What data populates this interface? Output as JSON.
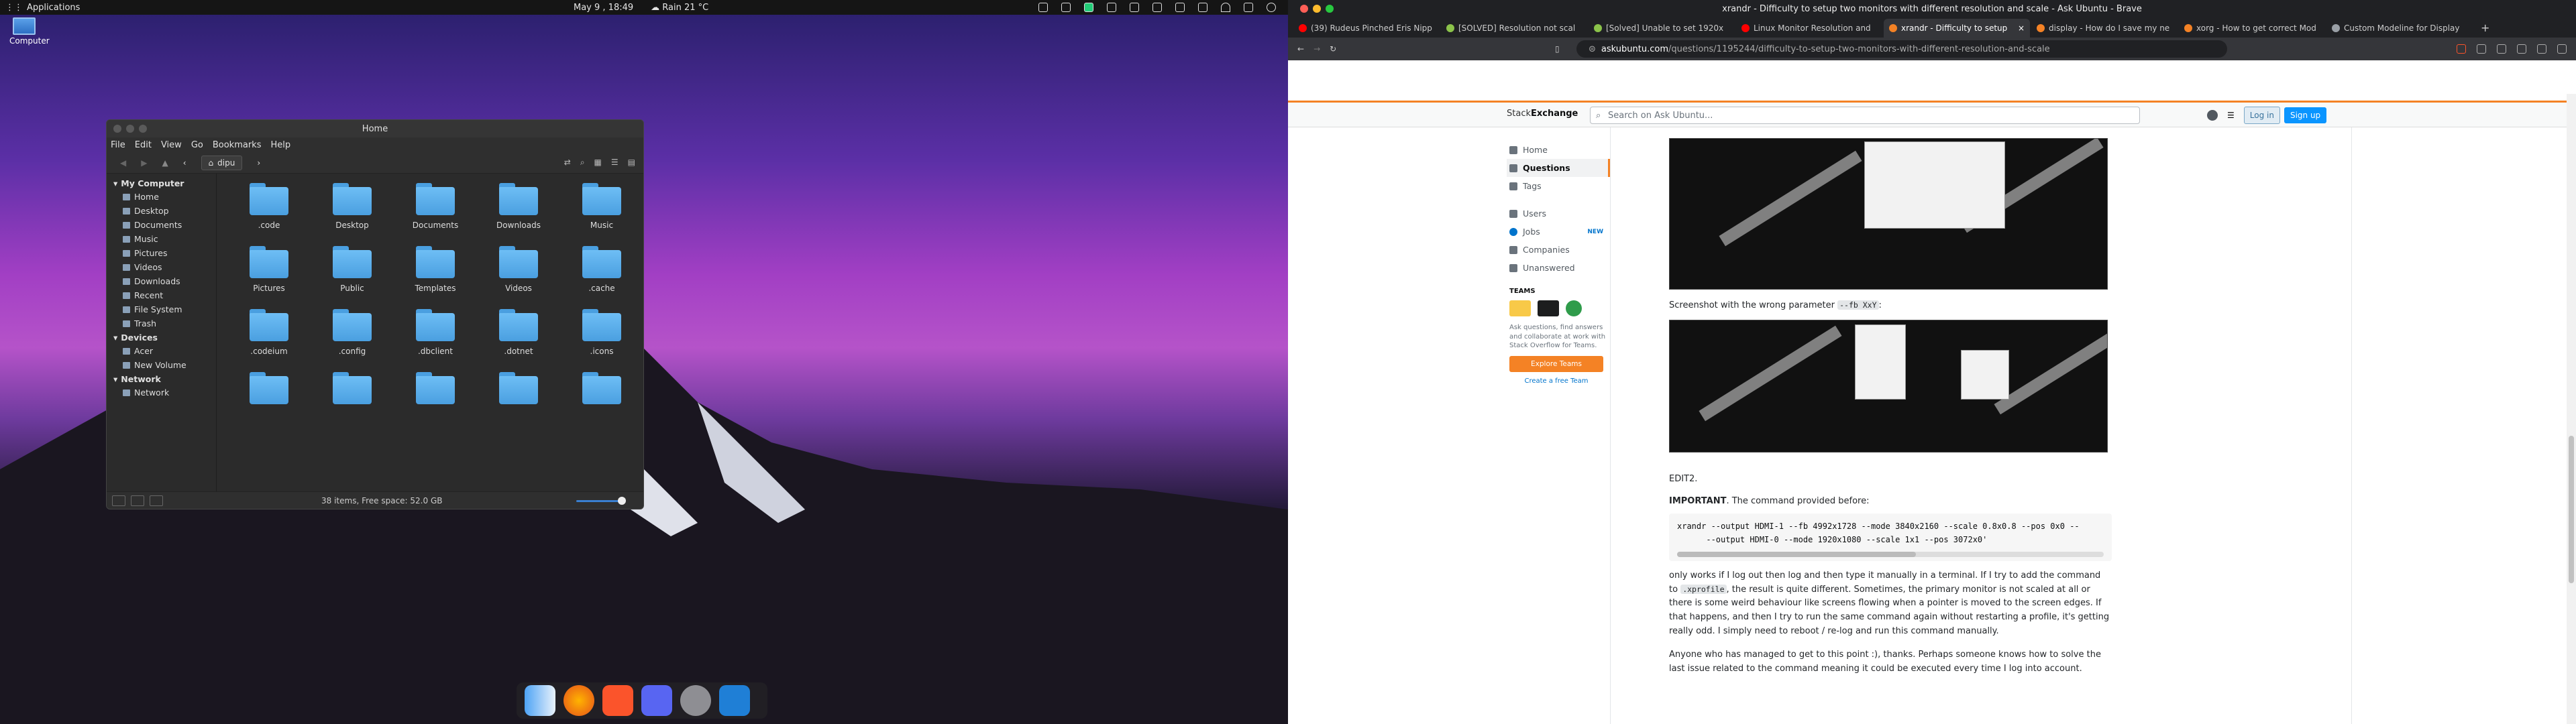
{
  "topbar": {
    "apps_label": "Applications",
    "date": "May 9 , 18:49",
    "weather": "Rain 21 °C"
  },
  "desktop": {
    "computer_label": "Computer"
  },
  "file_manager": {
    "title": "Home",
    "menu": [
      "File",
      "Edit",
      "View",
      "Go",
      "Bookmarks",
      "Help"
    ],
    "path": "dipu",
    "sidebar": {
      "my_computer": "My Computer",
      "places": [
        "Home",
        "Desktop",
        "Documents",
        "Music",
        "Pictures",
        "Videos",
        "Downloads",
        "Recent",
        "File System",
        "Trash"
      ],
      "devices": "Devices",
      "device_items": [
        "Acer",
        "New Volume"
      ],
      "network": "Network",
      "network_items": [
        "Network"
      ]
    },
    "folders": [
      ".code",
      "Desktop",
      "Documents",
      "Downloads",
      "Music",
      "Pictures",
      "Public",
      "Templates",
      "Videos",
      ".cache",
      ".codeium",
      ".config",
      ".dbclient",
      ".dotnet",
      ".icons",
      "",
      "",
      "",
      "",
      ""
    ],
    "status": "38 items, Free space: 52.0 GB"
  },
  "browser": {
    "window_title": "xrandr - Difficulty to setup two monitors with different resolution and scale - Ask Ubuntu - Brave",
    "tabs": [
      {
        "label": "(39) Rudeus Pinched Eris Nipp",
        "color": "#ff0000"
      },
      {
        "label": "[SOLVED] Resolution not scal",
        "color": "#8bc34a"
      },
      {
        "label": "[Solved] Unable to set 1920x",
        "color": "#8bc34a"
      },
      {
        "label": "Linux Monitor Resolution and",
        "color": "#ff0000"
      },
      {
        "label": "xrandr - Difficulty to setup",
        "color": "#f48225"
      },
      {
        "label": "display - How do I save my ne",
        "color": "#f48225"
      },
      {
        "label": "xorg - How to get correct Mod",
        "color": "#f48225"
      },
      {
        "label": "Custom Modeline for Display",
        "color": "#9aa0a6"
      }
    ],
    "url_host": "askubuntu.com",
    "url_path": "/questions/1195244/difficulty-to-setup-two-monitors-with-different-resolution-and-scale"
  },
  "page": {
    "logo": "Stack",
    "logo_bold": "Exchange",
    "search_placeholder": "Search on Ask Ubuntu...",
    "login": "Log in",
    "signup": "Sign up",
    "nav": [
      "Home",
      "Questions",
      "Tags",
      "Users",
      "Jobs",
      "Companies",
      "Unanswered"
    ],
    "jobs_badge": "NEW",
    "teams_heading": "TEAMS",
    "teams_text": "Ask questions, find answers and collaborate at work with Stack Overflow for Teams.",
    "explore_teams": "Explore Teams",
    "create_team": "Create a free Team",
    "shot_caption_pre": "Screenshot with the wrong parameter ",
    "shot_caption_code": "--fb XxY",
    "shot_caption_post": ":",
    "edit2": "EDIT2.",
    "important": "IMPORTANT",
    "important_rest": ". The command provided before:",
    "code": "xrandr --output HDMI-1 --fb 4992x1728 --mode 3840x2160 --scale 0.8x0.8 --pos 0x0 --\n      --output HDMI-0 --mode 1920x1080 --scale 1x1 --pos 3072x0'",
    "para1_a": "only works if I log out then log and then type it manually in a terminal. If I try to add the command to ",
    "para1_code": ".xprofile",
    "para1_b": ", the result is quite different. Sometimes, the primary monitor is not scaled at all or there is some weird behaviour like screens flowing when a pointer is moved to the screen edges. If that happens, and then I try to run the same command again without restarting a profile, it's getting really odd. I simply need to reboot / re-log and run this command manually.",
    "para2": "Anyone who has managed to get to this point :), thanks. Perhaps someone knows how to solve the last issue related to the command meaning it could be executed every time I log into account."
  }
}
